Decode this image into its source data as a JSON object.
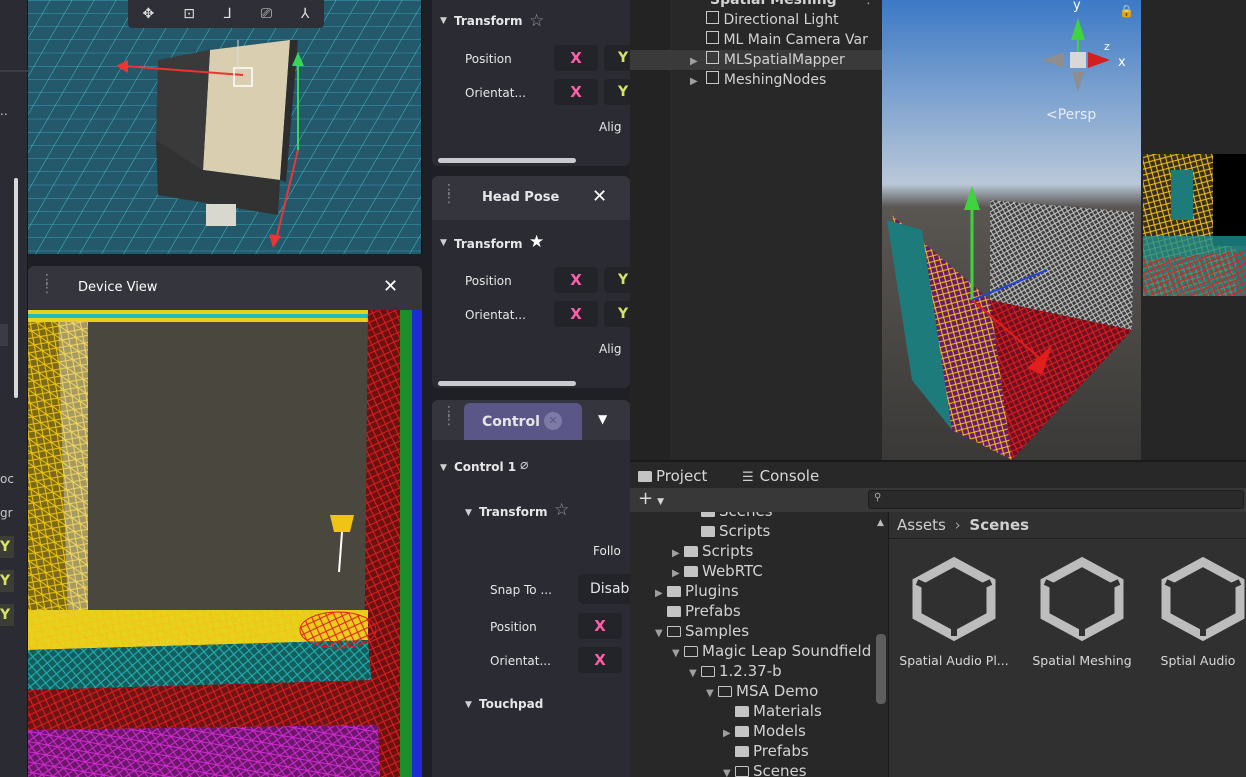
{
  "left_strip": {
    "y_labels": [
      "Y",
      "Y",
      "Y"
    ],
    "partial_texts": [
      "..",
      "oc",
      "gr"
    ]
  },
  "scene_top": {
    "toolbar_icons": [
      "move-icon",
      "rect-transform-icon",
      "pivot-icon",
      "camera-icon",
      "gizmo-icon"
    ]
  },
  "device_view": {
    "title": "Device View"
  },
  "inspector": {
    "panel1": {
      "section": "Transform",
      "position_label": "Position",
      "orientation_label": "Orientat...",
      "x": "X",
      "y": "Y",
      "align": "Alig"
    },
    "head_pose": {
      "title": "Head Pose",
      "section": "Transform",
      "position_label": "Position",
      "orientation_label": "Orientat...",
      "x": "X",
      "y": "Y",
      "align": "Alig"
    },
    "control": {
      "tab": "Control",
      "control1": "Control 1",
      "section": "Transform",
      "follow": "Follo",
      "snap_label": "Snap To ...",
      "snap_value": "Disab",
      "position_label": "Position",
      "orientation_label": "Orientat...",
      "x": "X",
      "touchpad": "Touchpad"
    }
  },
  "hierarchy": {
    "top_partial": "Spatial Meshing",
    "items": [
      "Directional Light",
      "ML Main Camera Var",
      "MLSpatialMapper",
      "MeshingNodes"
    ]
  },
  "unity_scene": {
    "persp_label": "Persp",
    "axes": [
      "y",
      "z",
      "x"
    ]
  },
  "project": {
    "tabs": [
      "Project",
      "Console"
    ],
    "tree": [
      {
        "label": "Scenes",
        "indent": 4,
        "arrow": "",
        "open": false
      },
      {
        "label": "Scripts",
        "indent": 4,
        "arrow": "",
        "open": false
      },
      {
        "label": "Scripts",
        "indent": 3,
        "arrow": "▶",
        "open": false
      },
      {
        "label": "WebRTC",
        "indent": 3,
        "arrow": "▶",
        "open": false
      },
      {
        "label": "Plugins",
        "indent": 2,
        "arrow": "▶",
        "open": false
      },
      {
        "label": "Prefabs",
        "indent": 2,
        "arrow": "",
        "open": false
      },
      {
        "label": "Samples",
        "indent": 2,
        "arrow": "▼",
        "open": true
      },
      {
        "label": "Magic Leap Soundfield",
        "indent": 3,
        "arrow": "▼",
        "open": true
      },
      {
        "label": "1.2.37-b",
        "indent": 4,
        "arrow": "▼",
        "open": true
      },
      {
        "label": "MSA Demo",
        "indent": 5,
        "arrow": "▼",
        "open": true
      },
      {
        "label": "Materials",
        "indent": 6,
        "arrow": "",
        "open": false
      },
      {
        "label": "Models",
        "indent": 6,
        "arrow": "▶",
        "open": false
      },
      {
        "label": "Prefabs",
        "indent": 6,
        "arrow": "",
        "open": false
      },
      {
        "label": "Scenes",
        "indent": 6,
        "arrow": "▼",
        "open": true
      }
    ],
    "breadcrumb": [
      "Assets",
      "Scenes"
    ],
    "assets": [
      "Spatial Audio Pl...",
      "Spatial Meshing",
      "Sptial Audio"
    ]
  }
}
